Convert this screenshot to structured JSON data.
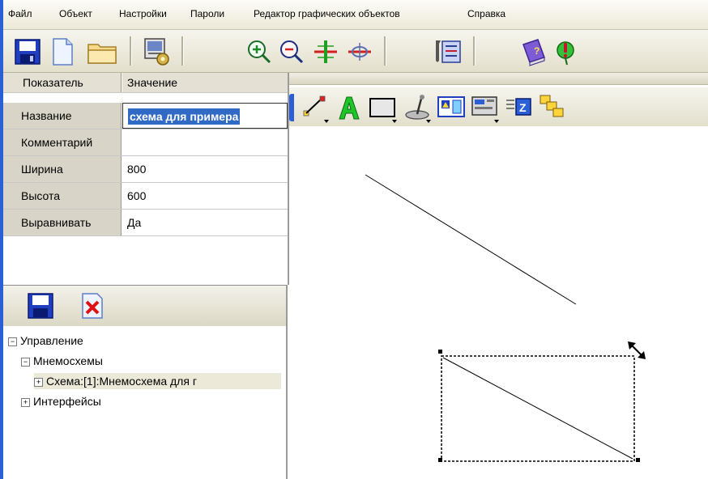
{
  "menu": {
    "items": [
      "Файл",
      "Объект",
      "Настройки",
      "Пароли",
      "Редактор графических объектов",
      "Справка"
    ]
  },
  "toolbar": {
    "buttons": [
      "save-icon",
      "new-document-icon",
      "open-folder-icon",
      "settings-computer-icon",
      "zoom-in-icon",
      "zoom-out-icon",
      "add-point-icon",
      "remove-point-icon",
      "tools-list-icon",
      "help-book-icon",
      "info-icon"
    ]
  },
  "properties": {
    "header": {
      "key": "Показатель",
      "value": "Значение"
    },
    "rows": [
      {
        "key": "Название",
        "value": "схема для примера",
        "checked": "√"
      },
      {
        "key": "Комментарий",
        "value": ""
      },
      {
        "key": "Ширина",
        "value": "800"
      },
      {
        "key": "Высота",
        "value": "600"
      },
      {
        "key": "Выравнивать",
        "value": "Да"
      }
    ]
  },
  "tree": {
    "nodes": [
      {
        "label": "Управление",
        "expander": "−"
      },
      {
        "label": "Мнемосхемы",
        "expander": "−"
      },
      {
        "label": "Схема:[1]:Мнемосхема для г",
        "expander": "+"
      },
      {
        "label": "Интерфейсы",
        "expander": "+"
      }
    ]
  },
  "graphics_toolbar": {
    "tools": [
      "line-tool-icon",
      "text-tool-icon",
      "rectangle-tool-icon",
      "pointer-tool-icon",
      "image-tool-icon",
      "device-tool-icon",
      "layer-order-icon",
      "group-icon"
    ]
  },
  "colors": {
    "accent_blue": "#2a5fd6",
    "selection": "#316ac5",
    "grid_key_bg": "#d8d5c8",
    "toolbar_bg": "#ece9d8"
  }
}
